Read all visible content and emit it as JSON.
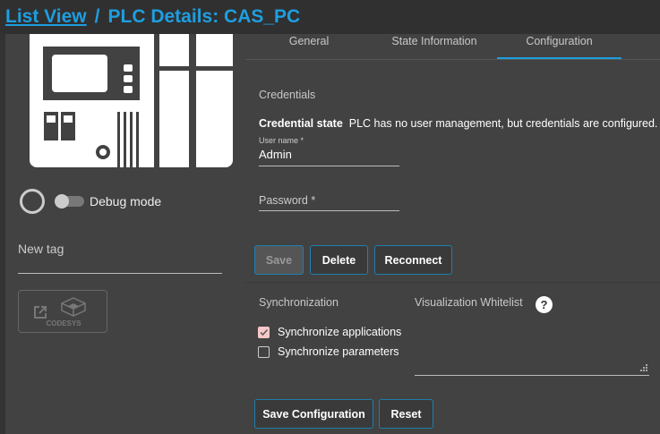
{
  "breadcrumb": {
    "list_view": "List View",
    "separator": "/",
    "current": "PLC Details: CAS_PC"
  },
  "tabs": [
    {
      "label": "General"
    },
    {
      "label": "State Information"
    },
    {
      "label": "Configuration",
      "active": true
    }
  ],
  "left": {
    "debug_mode_label": "Debug mode",
    "debug_mode_on": false,
    "tag_placeholder": "New tag",
    "codesys_label": "CODESYS"
  },
  "credentials": {
    "heading": "Credentials",
    "state_label": "Credential state",
    "state_value": "PLC has no user management, but credentials are configured.",
    "username_label": "User name *",
    "username_value": "Admin",
    "password_label": "Password *",
    "save": "Save",
    "delete": "Delete",
    "reconnect": "Reconnect"
  },
  "sync": {
    "heading": "Synchronization",
    "items": [
      {
        "label": "Synchronize applications",
        "checked": true
      },
      {
        "label": "Synchronize parameters",
        "checked": false
      }
    ]
  },
  "whitelist": {
    "heading": "Visualization Whitelist",
    "help_icon": "question-circle-icon"
  },
  "actions": {
    "save_configuration": "Save Configuration",
    "reset": "Reset"
  },
  "colors": {
    "accent": "#1e9ee0",
    "background": "#424242",
    "topbar": "#303030",
    "checkbox_checked": "#f8c8c8"
  }
}
